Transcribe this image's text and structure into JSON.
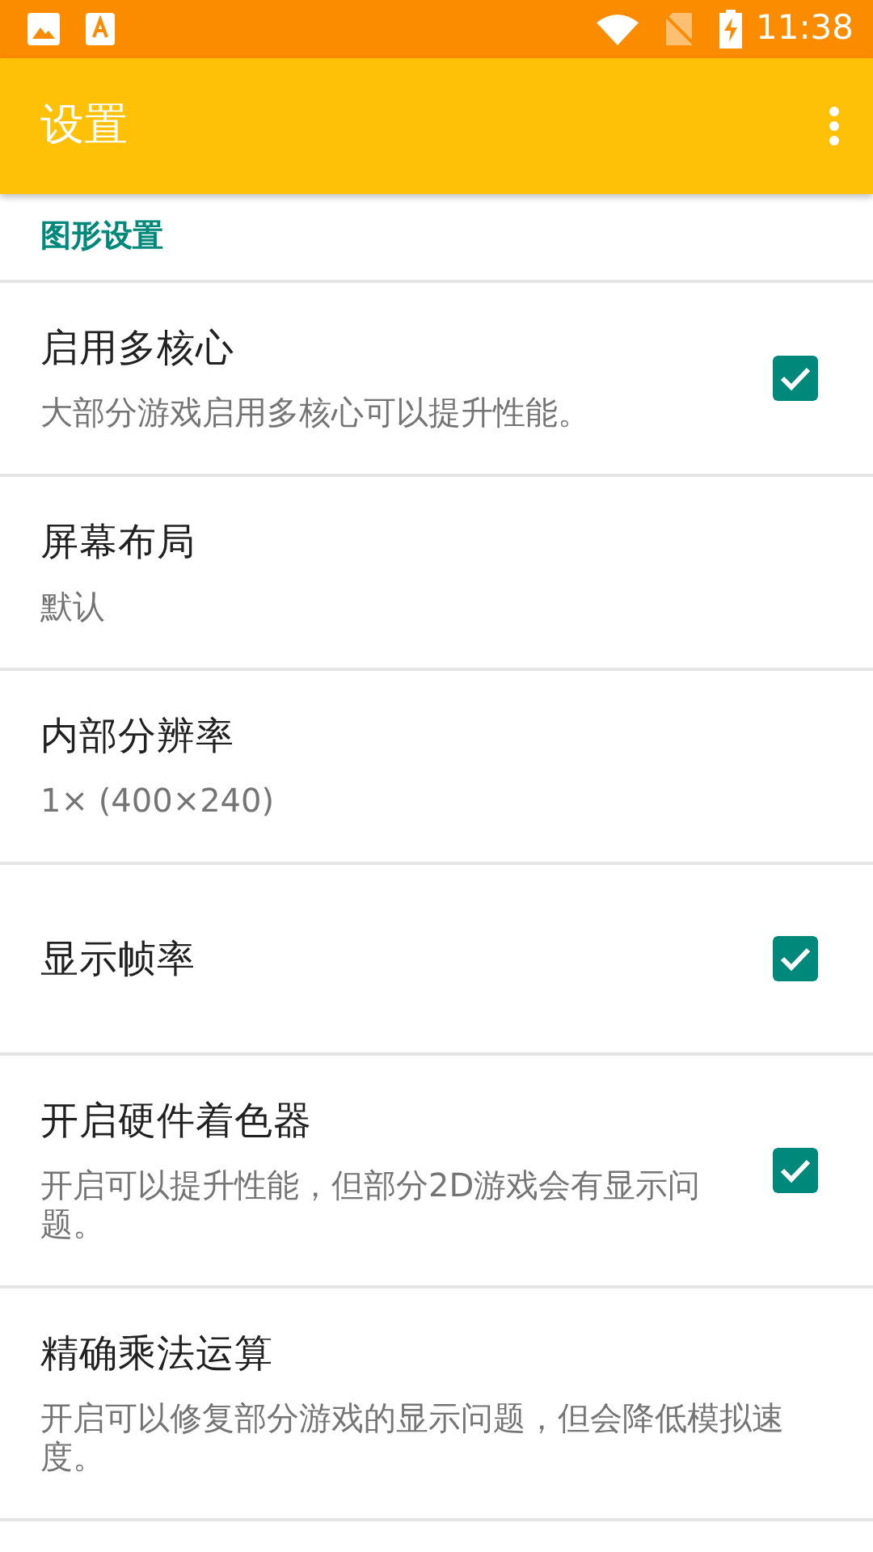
{
  "status_bar": {
    "time": "11:38"
  },
  "app_bar": {
    "title": "设置"
  },
  "category": {
    "title": "图形设置"
  },
  "preferences": [
    {
      "kind": "checkbox",
      "title": "启用多核心",
      "summary": "大部分游戏启用多核心可以提升性能。",
      "checked": true
    },
    {
      "kind": "list",
      "title": "屏幕布局",
      "summary": "默认"
    },
    {
      "kind": "list",
      "title": "内部分辨率",
      "summary": "1× (400×240)"
    },
    {
      "kind": "checkbox",
      "title": "显示帧率",
      "checked": true
    },
    {
      "kind": "checkbox",
      "title": "开启硬件着色器",
      "summary": "开启可以提升性能，但部分2D游戏会有显示问题。",
      "checked": true
    },
    {
      "kind": "text",
      "title": "精确乘法运算",
      "summary": "开启可以修复部分游戏的显示问题，但会降低模拟速度。"
    }
  ]
}
